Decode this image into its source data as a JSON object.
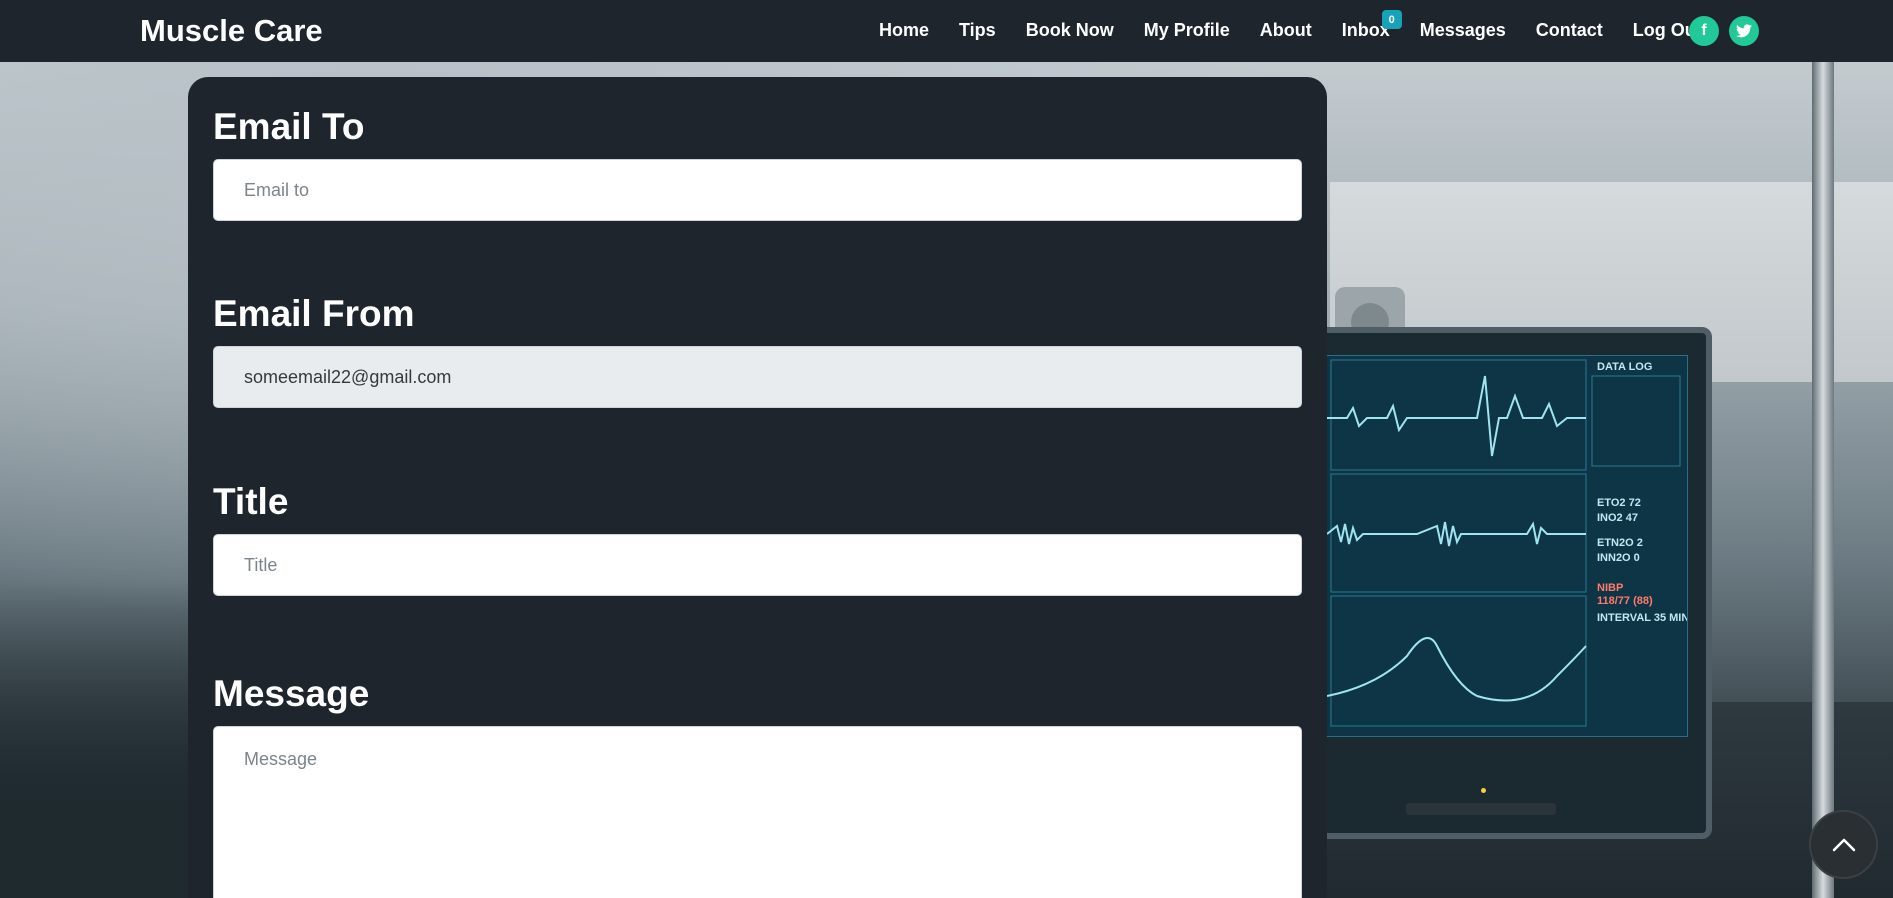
{
  "navbar": {
    "brand": "Muscle Care",
    "links": [
      "Home",
      "Tips",
      "Book Now",
      "My Profile",
      "About",
      "Inbox",
      "Messages",
      "Contact",
      "Log Out"
    ],
    "inbox_badge": "0",
    "social": {
      "facebook_icon": "f",
      "twitter_icon": "twitter-bird"
    }
  },
  "form": {
    "email_to": {
      "label": "Email To",
      "placeholder": "Email to",
      "value": ""
    },
    "email_from": {
      "label": "Email From",
      "value": "someemail22@gmail.com"
    },
    "title": {
      "label": "Title",
      "placeholder": "Title",
      "value": ""
    },
    "message": {
      "label": "Message",
      "placeholder": "Message",
      "value": ""
    }
  },
  "colors": {
    "navbar_bg": "#1e252d",
    "card_bg": "#1e252d",
    "social_accent": "#20c997",
    "badge": "#17a2b8"
  },
  "icons": {
    "back_to_top": "chevron-up-icon"
  }
}
